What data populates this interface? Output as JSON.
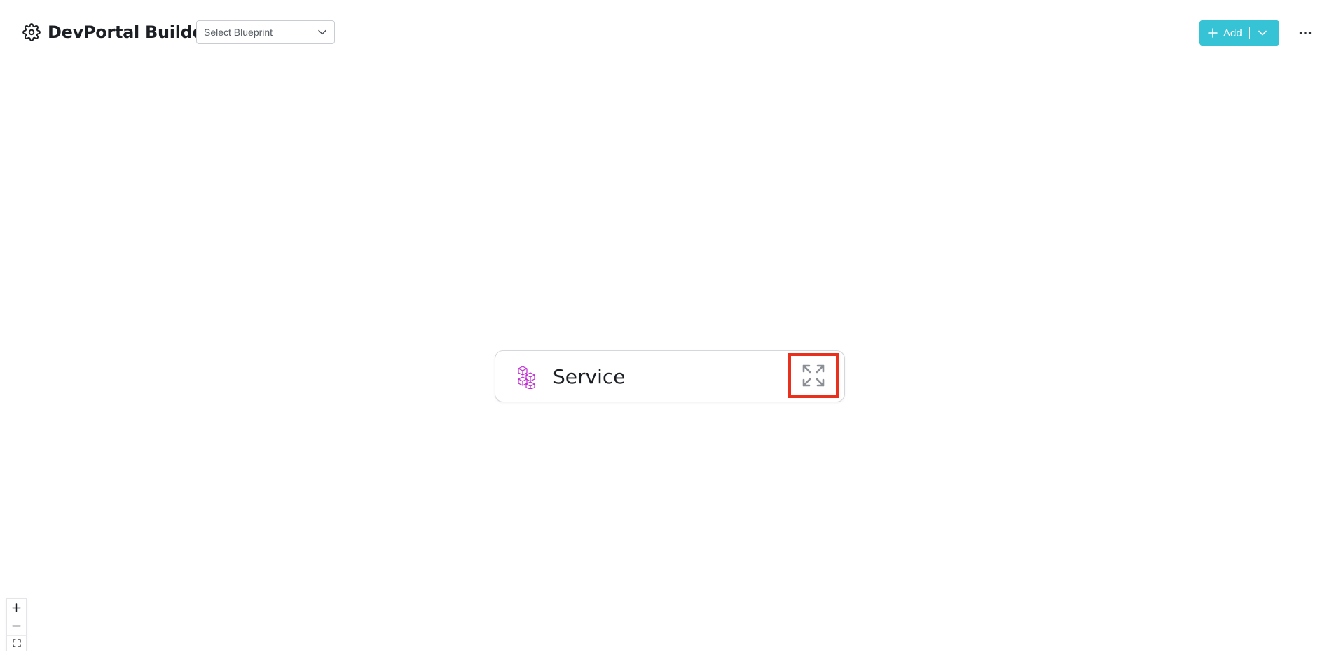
{
  "header": {
    "title": "DevPortal Builder",
    "blueprint_select": {
      "selected": "Select Blueprint"
    },
    "add_button": {
      "label": "Add"
    },
    "accent_color": "#36c3d6"
  },
  "canvas": {
    "node": {
      "label": "Service",
      "icon": "cubes-icon",
      "icon_color": "#c026d3",
      "expand_icon": "expand-arrows-icon",
      "highlight_color": "#e8301c"
    }
  },
  "zoom_controls": {
    "zoom_in_icon": "plus-icon",
    "zoom_out_icon": "minus-icon",
    "fit_view_icon": "fit-view-icon"
  }
}
